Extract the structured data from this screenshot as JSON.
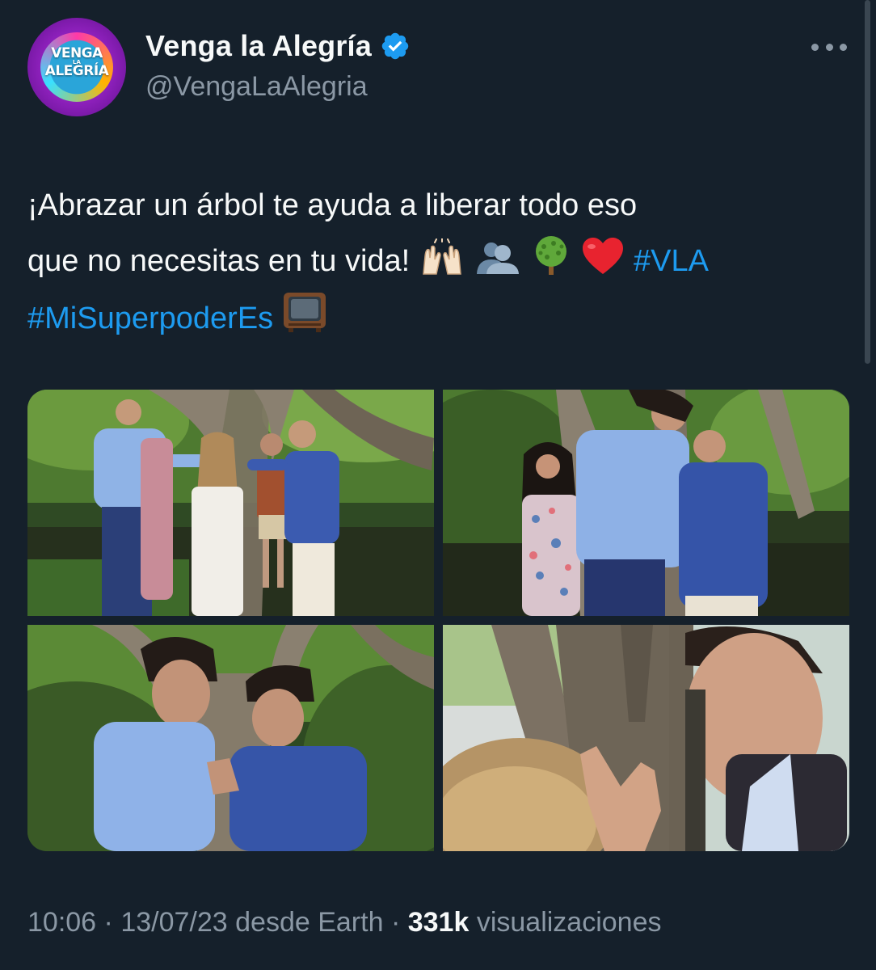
{
  "account": {
    "display_name": "Venga la Alegría",
    "handle": "@VengaLaAlegria",
    "avatar_lettering": [
      "VENGA",
      "LA",
      "ALEGRÍA"
    ],
    "verified": true,
    "verified_color": "#1d9bf0"
  },
  "tweet": {
    "line1": "¡Abrazar un árbol te ayuda a liberar todo eso",
    "line2_text": "que no necesitas en tu vida!",
    "line2_emojis": [
      "raised-hands-emoji",
      "busts-emoji",
      "tree-emoji",
      "red-heart-emoji"
    ],
    "hashtag1": "#VLA",
    "hashtag2": "#MiSuperpoderEs",
    "trailing_emoji": "television-emoji"
  },
  "photos": [
    {
      "name": "photo-1"
    },
    {
      "name": "photo-2"
    },
    {
      "name": "photo-3"
    },
    {
      "name": "photo-4"
    }
  ],
  "footer": {
    "time": "10:06",
    "date": "13/07/23",
    "source": "desde Earth",
    "views_count": "331k",
    "views_label": "visualizaciones"
  },
  "colors": {
    "background": "#15202b",
    "text_primary": "#f7f9f9",
    "text_secondary": "#8b98a5",
    "link": "#1d9bf0"
  }
}
